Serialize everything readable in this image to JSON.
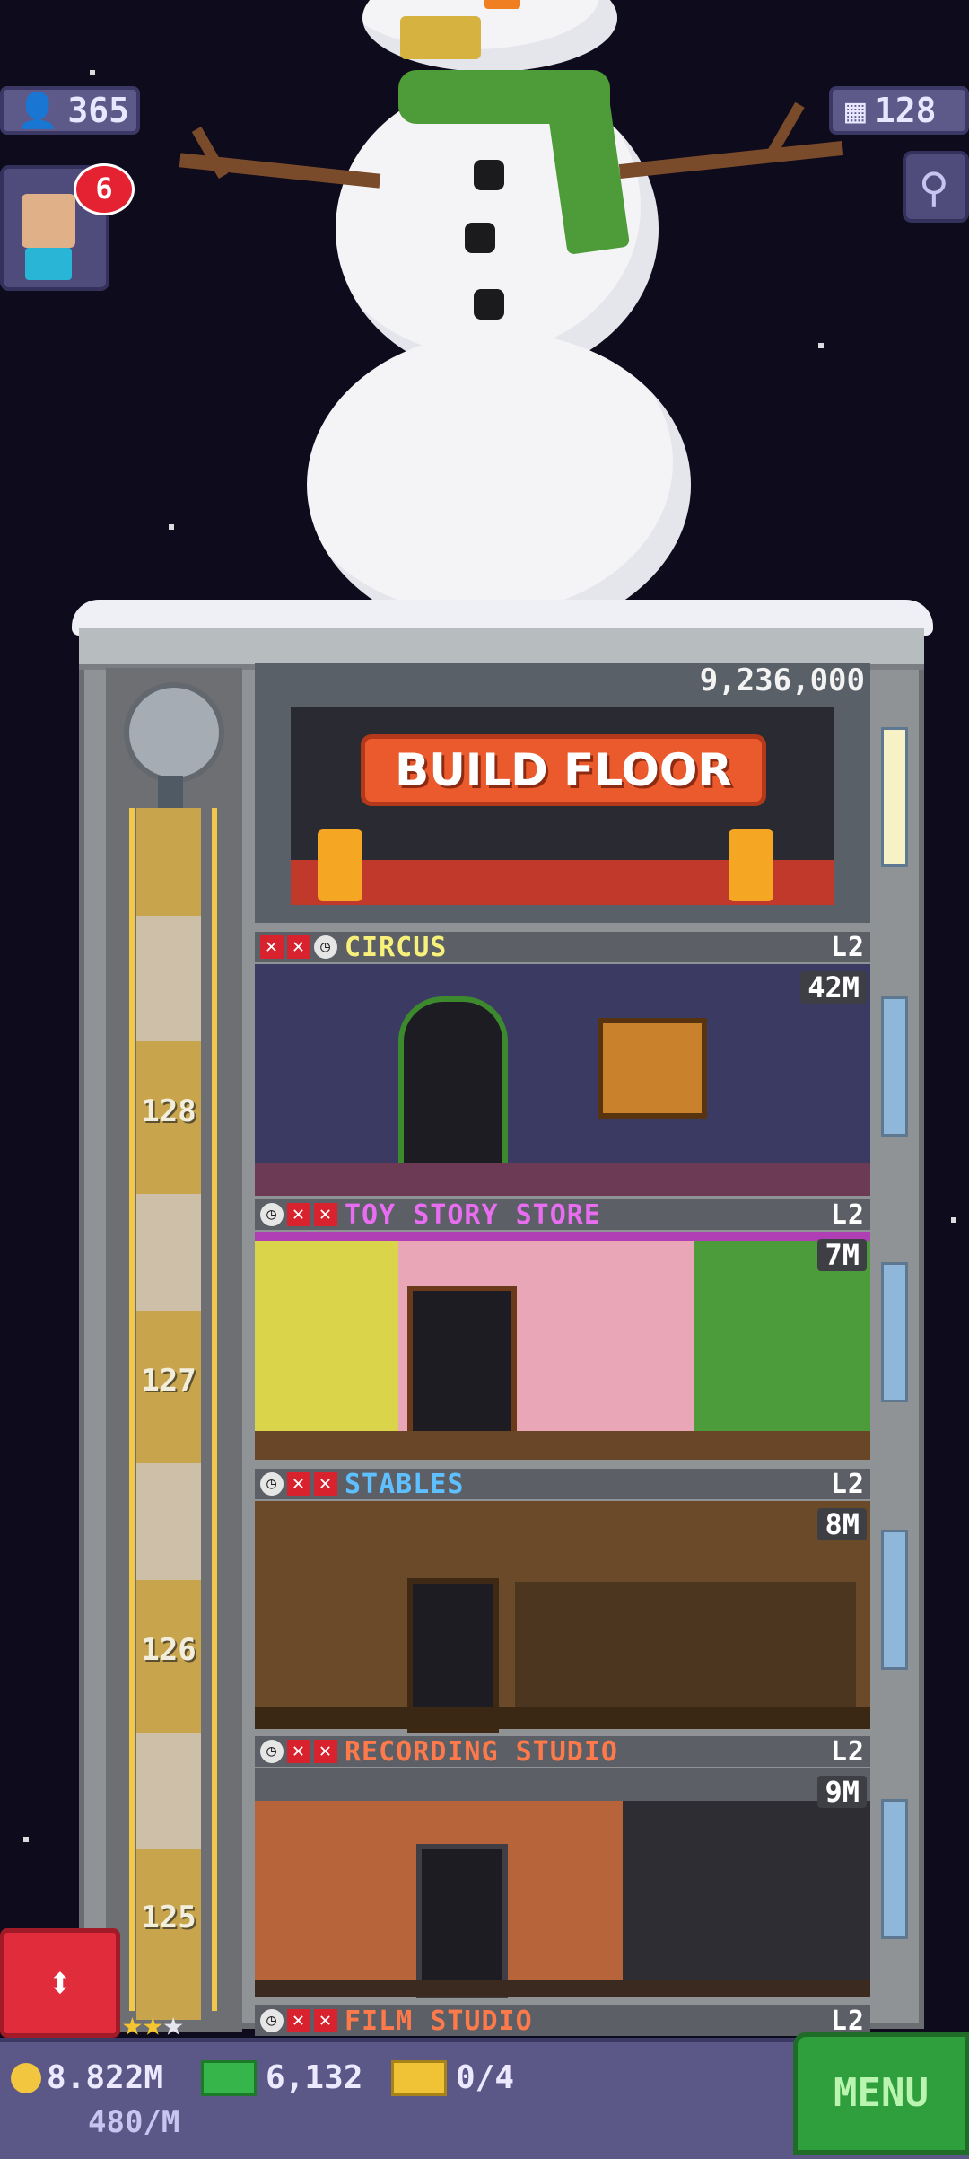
{
  "hud": {
    "population": "365",
    "floor_count": "128",
    "notification_count": "6"
  },
  "build_floor": {
    "price": "9,236,000",
    "label": "BUILD FLOOR"
  },
  "floors": [
    {
      "name": "CIRCUS",
      "level": "L2",
      "income": "42M",
      "number": "128",
      "name_color": "#f7f07a"
    },
    {
      "name": "TOY STORY STORE",
      "level": "L2",
      "income": "7M",
      "number": "127",
      "name_color": "#e86df0"
    },
    {
      "name": "STABLES",
      "level": "L2",
      "income": "8M",
      "number": "126",
      "name_color": "#5ec0ff"
    },
    {
      "name": "RECORDING STUDIO",
      "level": "L2",
      "income": "9M",
      "number": "125",
      "name_color": "#ff7a4a"
    },
    {
      "name": "FILM STUDIO",
      "level": "L2",
      "income": "",
      "number": "",
      "name_color": "#ff7a4a"
    }
  ],
  "bottom": {
    "coins": "8.822M",
    "bux": "6,132",
    "tickets": "0/4",
    "rate": "480/M",
    "menu_label": "MENU"
  },
  "icons": {
    "population": "person-icon",
    "floors": "building-icon",
    "search": "magnifier-icon",
    "elevator": "up-down-arrows-icon"
  }
}
